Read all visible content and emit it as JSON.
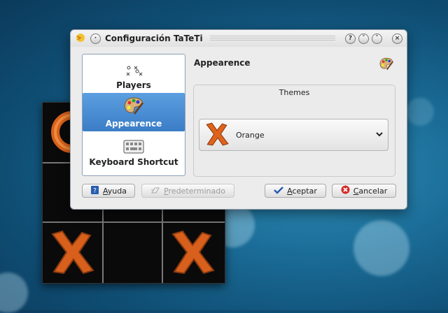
{
  "dialog": {
    "title": "Configuración TaTeTi",
    "titlebar_buttons": [
      "?",
      "˅",
      "˄",
      "×"
    ]
  },
  "sidebar": {
    "items": [
      {
        "label": "Players",
        "icon": "players-icon",
        "selected": false
      },
      {
        "label": "Appearence",
        "icon": "palette-icon",
        "selected": true
      },
      {
        "label": "Keyboard Shortcut",
        "icon": "keyboard-icon",
        "selected": false
      }
    ]
  },
  "page": {
    "title": "Appearence",
    "icon": "palette-icon"
  },
  "themes": {
    "group_title": "Themes",
    "selected": "Orange"
  },
  "buttons": {
    "help": {
      "mnemonic": "A",
      "rest": "yuda"
    },
    "defaults": {
      "mnemonic": "P",
      "rest": "redeterminado"
    },
    "accept": {
      "mnemonic": "A",
      "rest": "ceptar"
    },
    "cancel": {
      "mnemonic": "C",
      "rest": "ancelar"
    }
  },
  "colors": {
    "accent": "#3a7dc6",
    "theme_orange": "#e0631c",
    "desktop": "#1a6c97"
  }
}
